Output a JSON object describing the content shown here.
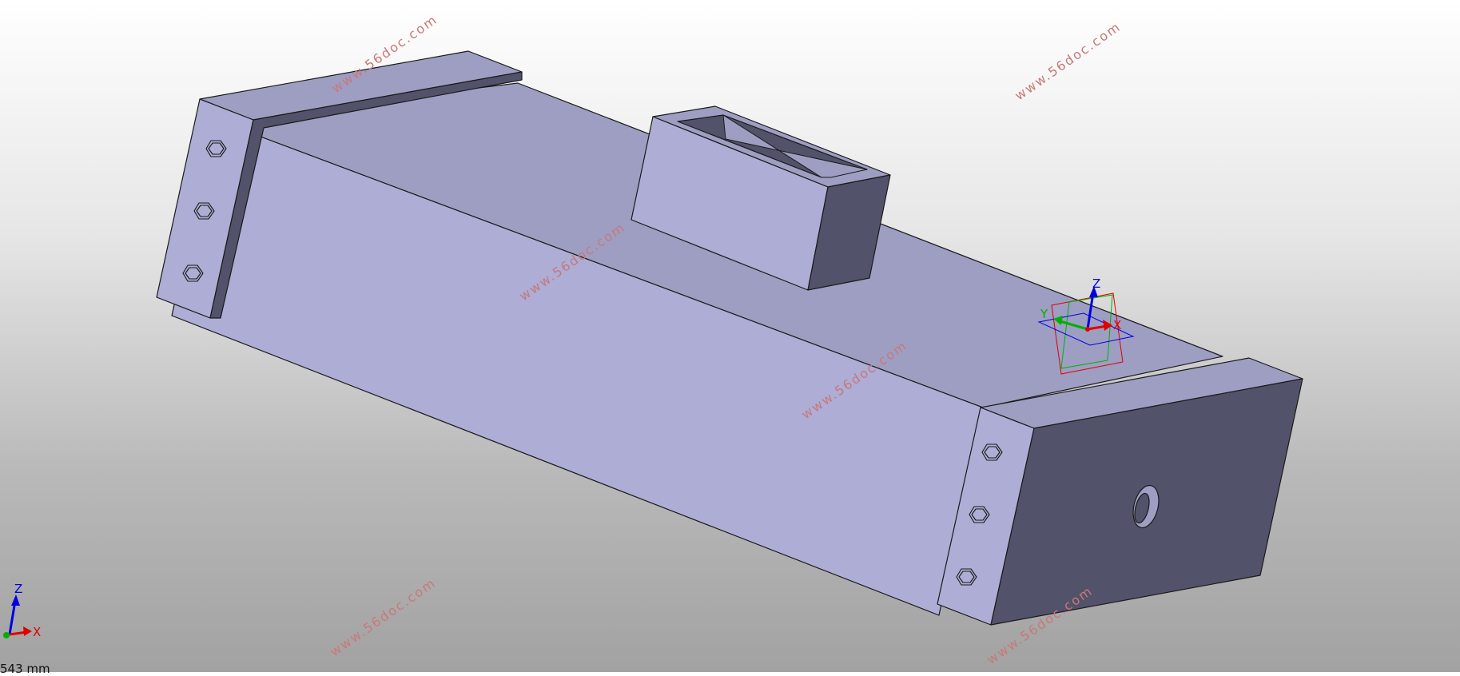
{
  "watermarks": [
    {
      "text": "www.56doc.com"
    },
    {
      "text": "www.56doc.com"
    },
    {
      "text": "www.56doc.com"
    },
    {
      "text": "www.56doc.com"
    },
    {
      "text": "www.56doc.com"
    },
    {
      "text": "www.56doc.com"
    }
  ],
  "model_triad": {
    "z": "Z",
    "y": "Y",
    "x": "X"
  },
  "view_triad": {
    "z": "Z",
    "x": "X"
  },
  "scale_text": "543 mm",
  "colors": {
    "face_light": "#adadd5",
    "face_top": "#9e9ec3",
    "face_dark": "#52526a",
    "edge": "#1a1a1a",
    "axis_x": "#e00000",
    "axis_y": "#00b000",
    "axis_z": "#0000e0"
  }
}
